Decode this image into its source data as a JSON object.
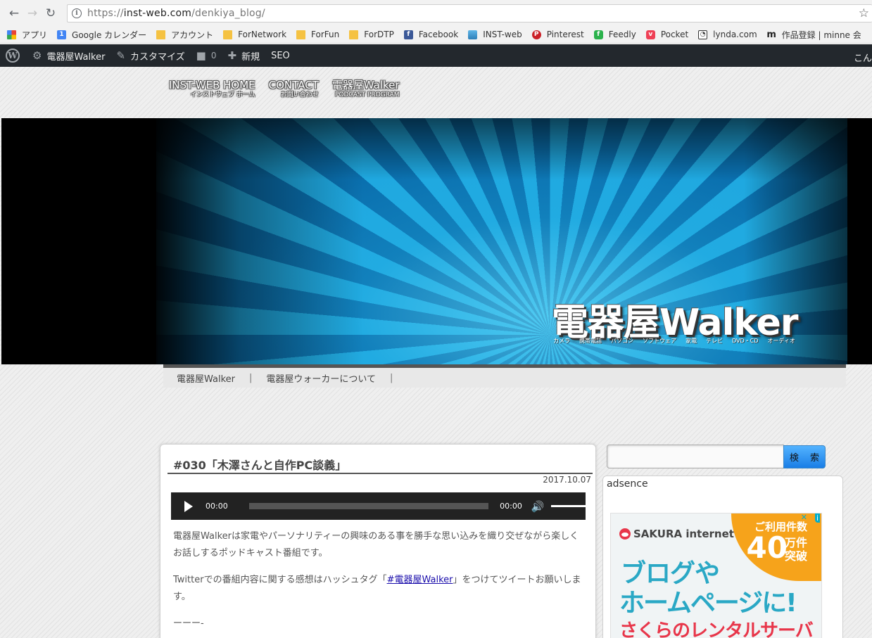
{
  "browser": {
    "url_scheme": "https://",
    "url_host": "inst-web.com",
    "url_path": "/denkiya_blog/",
    "bookmarks": [
      {
        "label": "アプリ",
        "icon": "apps-grid-icon"
      },
      {
        "label": "Google カレンダー",
        "icon": "google-calendar-icon",
        "glyph": "1"
      },
      {
        "label": "アカウント",
        "icon": "folder-icon"
      },
      {
        "label": "ForNetwork",
        "icon": "folder-icon"
      },
      {
        "label": "ForFun",
        "icon": "folder-icon"
      },
      {
        "label": "ForDTP",
        "icon": "folder-icon"
      },
      {
        "label": "Facebook",
        "icon": "facebook-icon",
        "glyph": "f"
      },
      {
        "label": "INST-web",
        "icon": "inst-web-icon"
      },
      {
        "label": "Pinterest",
        "icon": "pinterest-icon",
        "glyph": "P"
      },
      {
        "label": "Feedly",
        "icon": "feedly-icon",
        "glyph": "f"
      },
      {
        "label": "Pocket",
        "icon": "pocket-icon",
        "glyph": "v"
      },
      {
        "label": "lynda.com",
        "icon": "lynda-icon",
        "glyph": "◔"
      },
      {
        "label": "作品登録 | minne 会",
        "icon": "minne-icon",
        "glyph": "m"
      }
    ]
  },
  "wp_admin_bar": {
    "site_name": "電器屋Walker",
    "customize": "カスタマイズ",
    "comments_count": "0",
    "new": "新規",
    "seo": "SEO",
    "greeting": "こん"
  },
  "site": {
    "topnav": [
      {
        "main": "INST-WEB HOME",
        "sub": "インストウェブ ホーム"
      },
      {
        "main": "CONTACT",
        "sub": "お問い合わせ"
      },
      {
        "main": "電器屋Walker",
        "sub": "PODCAST PROGRAM"
      }
    ],
    "logo_title": "電器屋Walker",
    "logo_categories": [
      "カメラ",
      "携帯電話",
      "パソコン",
      "ソフトウェア",
      "家電",
      "テレビ",
      "DVD・CD",
      "オーディオ"
    ],
    "subnav": [
      "電器屋Walker",
      "電器屋ウォーカーについて"
    ]
  },
  "post": {
    "title": "#030「木澤さんと自作PC談義」",
    "date": "2017.10.07",
    "player": {
      "current": "00:00",
      "duration": "00:00",
      "progress": 0,
      "volume": 1.0
    },
    "p1": "電器屋Walkerは家電やパーソナリティーの興味のある事を勝手な思い込みを織り交ぜながら楽しくお話しするポッドキャスト番組です。",
    "p2_before": "Twitterでの番組内容に関する感想はハッシュタグ「",
    "p2_hashtag": "#電器屋Walker",
    "p2_after": "」をつけてツイートお願いします。",
    "p3": "ーーー-"
  },
  "sidebar": {
    "search_placeholder": "",
    "search_button": "検 索",
    "widget_title": "adsence",
    "ad": {
      "brand": "SAKURA internet",
      "badge_top": "ご利用件数",
      "badge_num": "40",
      "badge_unit": "万件突破",
      "line1": "ブログや",
      "line2": "ホームページに!",
      "line3": "さくらのレンタルサーバ"
    }
  }
}
